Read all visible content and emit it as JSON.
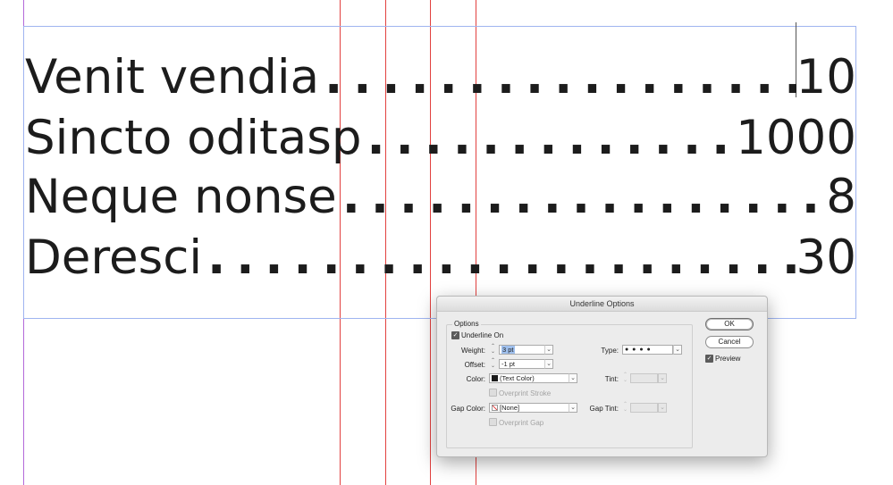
{
  "toc": {
    "rows": [
      {
        "entry": "Venit vendia",
        "leader": "................................",
        "page": "10"
      },
      {
        "entry": "Sincto oditasp",
        "leader": "................................",
        "page": "1000"
      },
      {
        "entry": "Neque nonse",
        "leader": "................................",
        "page": "8"
      },
      {
        "entry": "Deresci",
        "leader": "........................................",
        "page": "30"
      }
    ]
  },
  "guides": {
    "column_color": "#e2413f",
    "margin_color": "#b36ad9",
    "frame_color": "#9fb4f0"
  },
  "dialog": {
    "title": "Underline Options",
    "group_label": "Options",
    "underline_on": {
      "label": "Underline On",
      "checked": true
    },
    "weight": {
      "label": "Weight:",
      "value": "3 pt"
    },
    "offset": {
      "label": "Offset:",
      "value": "-1 pt"
    },
    "color": {
      "label": "Color:",
      "value": "(Text Color)",
      "swatch": "#1a1a1a"
    },
    "overprint_stroke": {
      "label": "Overprint Stroke",
      "checked": false
    },
    "gap_color": {
      "label": "Gap Color:",
      "value": "[None]",
      "swatch_icon": "none-swatch-icon"
    },
    "overprint_gap": {
      "label": "Overprint Gap",
      "checked": false
    },
    "type": {
      "label": "Type:",
      "value": "● ● ● ●"
    },
    "tint": {
      "label": "Tint:",
      "value": ""
    },
    "gap_tint": {
      "label": "Gap Tint:",
      "value": ""
    },
    "ok_label": "OK",
    "cancel_label": "Cancel",
    "preview": {
      "label": "Preview",
      "checked": true
    }
  }
}
